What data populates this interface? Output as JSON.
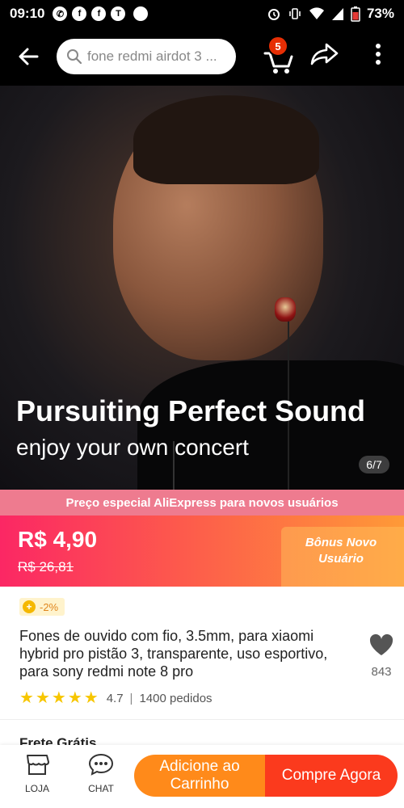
{
  "status_bar": {
    "time": "09:10",
    "battery_pct": "73%"
  },
  "header": {
    "search_placeholder": "fone redmi airdot 3 ...",
    "cart_count": "5"
  },
  "hero": {
    "title": "Pursuiting Perfect Sound",
    "subtitle": "enjoy your own concert",
    "image_counter": "6/7"
  },
  "promo": {
    "banner": "Preço especial AliExpress para novos usuários",
    "price": "R$ 4,90",
    "original_price": "R$ 26,81",
    "bonus": "Bônus Novo Usuário"
  },
  "product": {
    "discount": "-2%",
    "title": "Fones de ouvido com fio, 3.5mm, para xiaomi hybrid pro pistão 3, transparente, uso esportivo, para sony redmi note 8 pro",
    "wishlist_count": "843",
    "rating": "4.7",
    "orders": "1400 pedidos",
    "next_section_peek": "Frete Grátis"
  },
  "bottom_bar": {
    "store_label": "LOJA",
    "chat_label": "CHAT",
    "add_to_cart": "Adicione ao Carrinho",
    "buy_now": "Compre Agora"
  },
  "colors": {
    "accent": "#fb3a1d",
    "cart_button": "#ff8a1a",
    "promo_banner": "#ee7b8f",
    "star": "#f7c600"
  }
}
